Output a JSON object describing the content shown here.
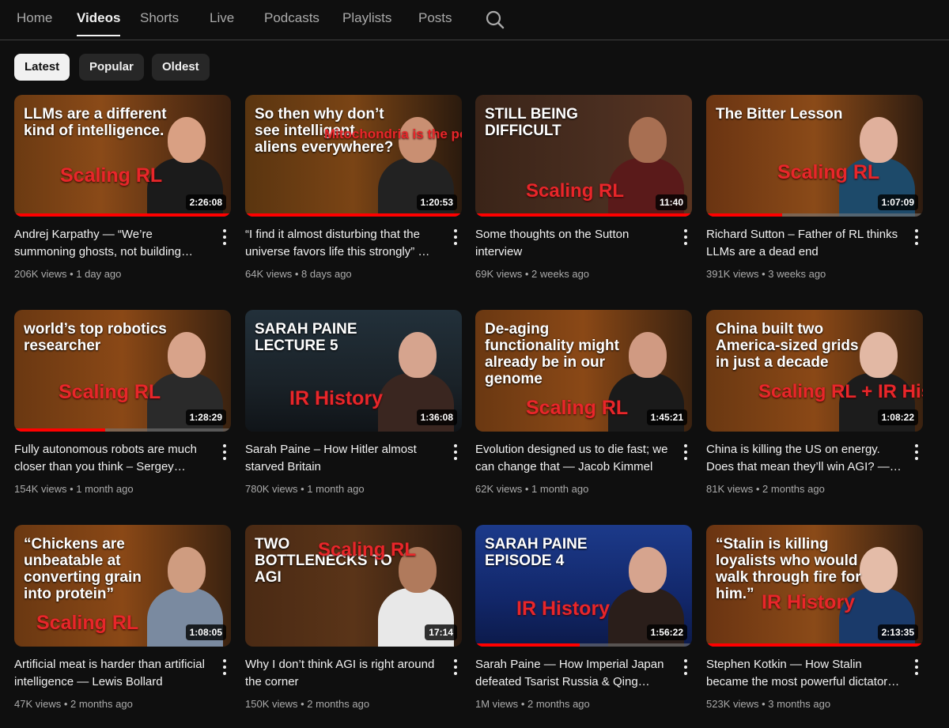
{
  "tabs": [
    {
      "label": "Home"
    },
    {
      "label": "Videos"
    },
    {
      "label": "Shorts"
    },
    {
      "label": "Live"
    },
    {
      "label": "Podcasts"
    },
    {
      "label": "Playlists"
    },
    {
      "label": "Posts"
    }
  ],
  "active_tab": "Videos",
  "filters": [
    {
      "label": "Latest",
      "selected": true
    },
    {
      "label": "Popular",
      "selected": false
    },
    {
      "label": "Oldest",
      "selected": false
    }
  ],
  "videos": [
    {
      "title": "Andrej Karpathy — “We’re summoning ghosts, not building animals”",
      "views": "206K views",
      "age": "1 day ago",
      "duration": "2:26:08",
      "watched": 1.0,
      "thumb_text": "LLMs are a different kind of intelligence.",
      "thumb_tag": "Scaling RL"
    },
    {
      "title": "“I find it almost disturbing that the universe favors life this strongly” — Nick Lane",
      "views": "64K views",
      "age": "8 days ago",
      "duration": "1:20:53",
      "watched": 1.0,
      "thumb_text": "So then why don’t see intelligent aliens everywhere?",
      "thumb_tag": "Mitochondria is the powerhouse of the cell"
    },
    {
      "title": "Some thoughts on the Sutton interview",
      "views": "69K views",
      "age": "2 weeks ago",
      "duration": "11:40",
      "watched": 1.0,
      "thumb_text": "STILL BEING DIFFICULT",
      "thumb_tag": "Scaling RL"
    },
    {
      "title": "Richard Sutton – Father of RL thinks LLMs are a dead end",
      "views": "391K views",
      "age": "3 weeks ago",
      "duration": "1:07:09",
      "watched": 0.35,
      "thumb_text": "The Bitter Lesson",
      "thumb_tag": "Scaling RL"
    },
    {
      "title": "Fully autonomous robots are much closer than you think – Sergey Levine",
      "views": "154K views",
      "age": "1 month ago",
      "duration": "1:28:29",
      "watched": 0.42,
      "thumb_text": "world’s top robotics researcher",
      "thumb_tag": "Scaling RL"
    },
    {
      "title": "Sarah Paine – How Hitler almost starved Britain",
      "views": "780K views",
      "age": "1 month ago",
      "duration": "1:36:08",
      "watched": 0,
      "thumb_text": "SARAH PAINE LECTURE 5",
      "thumb_tag": "IR History"
    },
    {
      "title": "Evolution designed us to die fast; we can change that — Jacob Kimmel",
      "views": "62K views",
      "age": "1 month ago",
      "duration": "1:45:21",
      "watched": 0,
      "thumb_text": "De-aging functionality might already be in our genome",
      "thumb_tag": "Scaling RL"
    },
    {
      "title": "China is killing the US on energy. Does that mean they’ll win AGI? — Casey Handmer",
      "views": "81K views",
      "age": "2 months ago",
      "duration": "1:08:22",
      "watched": 0,
      "thumb_text": "China built two America-sized grids in just a decade",
      "thumb_tag": "Scaling RL + IR History"
    },
    {
      "title": "Artificial meat is harder than artificial intelligence — Lewis Bollard",
      "views": "47K views",
      "age": "2 months ago",
      "duration": "1:08:05",
      "watched": 0,
      "thumb_text": "“Chickens are unbeatable at converting grain into protein”",
      "thumb_tag": "Scaling RL"
    },
    {
      "title": "Why I don’t think AGI is right around the corner",
      "views": "150K views",
      "age": "2 months ago",
      "duration": "17:14",
      "watched": 0,
      "thumb_text": "TWO BOTTLENECKS TO AGI",
      "thumb_tag": "Scaling RL"
    },
    {
      "title": "Sarah Paine — How Imperial Japan defeated Tsarist Russia & Qing China",
      "views": "1M views",
      "age": "2 months ago",
      "duration": "1:56:22",
      "watched": 0.48,
      "thumb_text": "SARAH PAINE EPISODE 4",
      "thumb_tag": "IR History"
    },
    {
      "title": "Stephen Kotkin — How Stalin became the most powerful dictator in history",
      "views": "523K views",
      "age": "3 months ago",
      "duration": "2:13:35",
      "watched": 1.0,
      "thumb_text": "“Stalin is killing loyalists who would walk through fire for him.”",
      "thumb_tag": "IR History"
    }
  ]
}
